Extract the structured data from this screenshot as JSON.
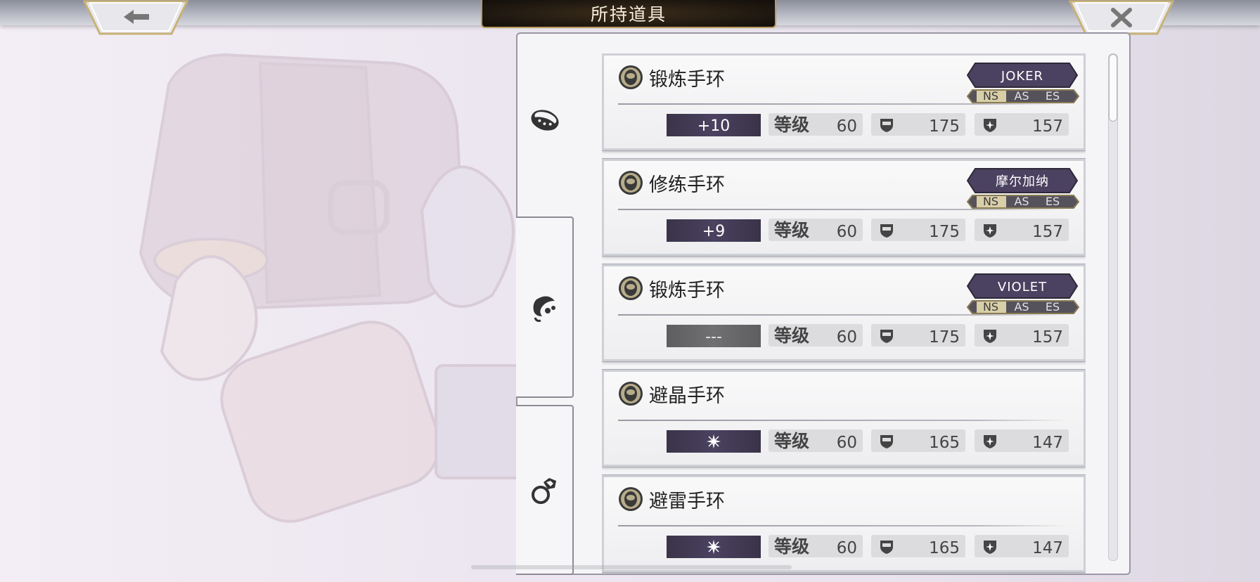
{
  "header": {
    "title": "所持道具"
  },
  "nav": {
    "back_icon": "arrow-left-icon",
    "close_icon": "close-icon"
  },
  "tabs": [
    {
      "icon": "bracelet-icon",
      "active": true
    },
    {
      "icon": "necklace-icon",
      "active": false
    },
    {
      "icon": "ring-icon",
      "active": false
    }
  ],
  "items": [
    {
      "name": "锻炼手环",
      "owner": "JOKER",
      "modes": [
        "NS",
        "AS",
        "ES"
      ],
      "active_mode": "NS",
      "plus": "+10",
      "level_label": "等级",
      "level": "60",
      "defense": "175",
      "magic_defense": "157"
    },
    {
      "name": "修练手环",
      "owner": "摩尔加纳",
      "modes": [
        "NS",
        "AS",
        "ES"
      ],
      "active_mode": "NS",
      "plus": "+9",
      "level_label": "等级",
      "level": "60",
      "defense": "175",
      "magic_defense": "157"
    },
    {
      "name": "锻炼手环",
      "owner": "VIOLET",
      "modes": [
        "NS",
        "AS",
        "ES"
      ],
      "active_mode": "NS",
      "plus": "---",
      "level_label": "等级",
      "level": "60",
      "defense": "175",
      "magic_defense": "157"
    },
    {
      "name": "避晶手环",
      "owner": "",
      "plus_icon": "sparkle-icon",
      "level_label": "等级",
      "level": "60",
      "defense": "165",
      "magic_defense": "147"
    },
    {
      "name": "避雷手环",
      "owner": "",
      "plus_icon": "sparkle-icon",
      "level_label": "等级",
      "level": "60",
      "defense": "165",
      "magic_defense": "147"
    }
  ],
  "colors": {
    "owner_plate": "#4b4160",
    "plus_bar": "#433b58",
    "title_gold": "#b89a5c"
  }
}
